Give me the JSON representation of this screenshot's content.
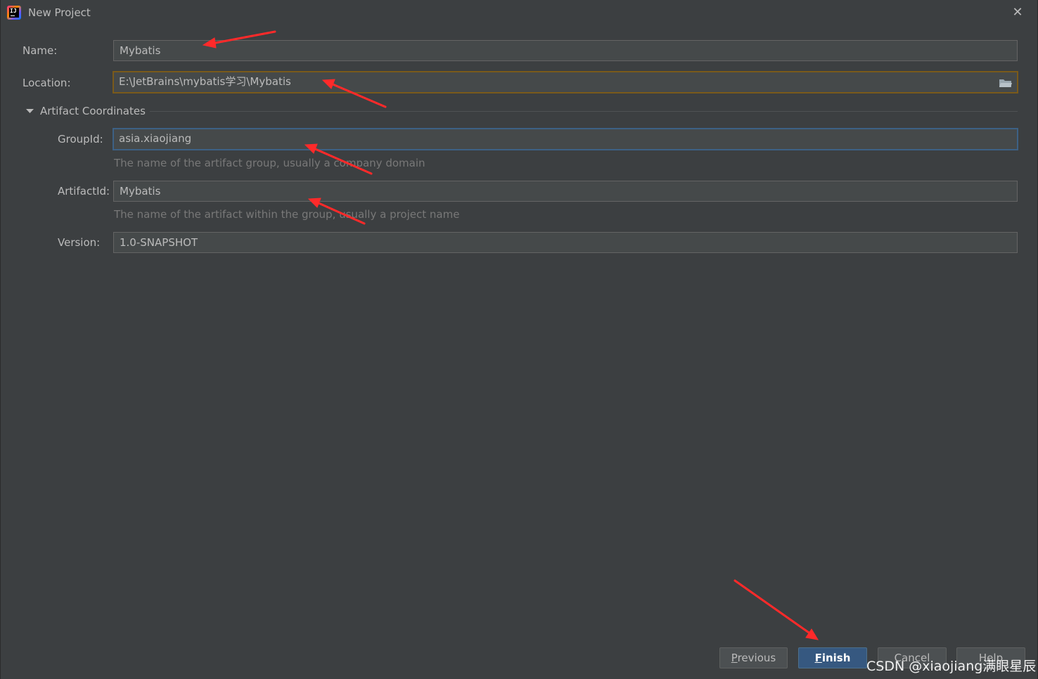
{
  "window": {
    "title": "New Project",
    "close_label": "✕"
  },
  "form": {
    "name": {
      "label": "Name:",
      "value": "Mybatis"
    },
    "location": {
      "label": "Location:",
      "value": "E:\\JetBrains\\mybatis学习\\Mybatis"
    },
    "artifact_section": {
      "title": "Artifact Coordinates"
    },
    "group_id": {
      "label": "GroupId:",
      "value": "asia.xiaojiang",
      "hint": "The name of the artifact group, usually a company domain"
    },
    "artifact_id": {
      "label": "ArtifactId:",
      "value": "Mybatis",
      "hint": "The name of the artifact within the group, usually a project name"
    },
    "version": {
      "label": "Version:",
      "value": "1.0-SNAPSHOT"
    }
  },
  "buttons": {
    "previous": {
      "mnemonic": "P",
      "rest": "revious"
    },
    "finish": {
      "mnemonic": "F",
      "rest": "inish"
    },
    "cancel": {
      "label": "Cancel"
    },
    "help": {
      "label": "Help"
    }
  },
  "watermark": "CSDN @xiaojiang满眼星辰",
  "colors": {
    "background": "#3c3f41",
    "field_bg": "#45494a",
    "focus_border": "#3d6185",
    "warning_border": "#7a5a1a",
    "primary_button": "#365880",
    "annotation_arrow": "#ff2a2a"
  }
}
